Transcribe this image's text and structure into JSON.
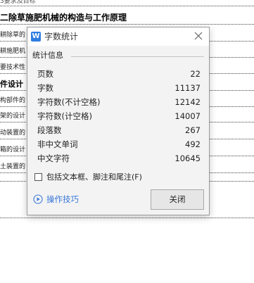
{
  "document": {
    "lines": [
      "3要求及目标",
      "二除草施肥机械的构造与工作原理",
      "耕除草的",
      "耕施肥机",
      "要技术性",
      "件设计",
      "构部件的",
      "架的设计",
      "动装置的",
      "箱的设计",
      "土装置的"
    ]
  },
  "dialog": {
    "title": "字数统计",
    "close_icon": "close-icon",
    "group_title": "统计信息",
    "stats": [
      {
        "label": "页数",
        "value": "22"
      },
      {
        "label": "字数",
        "value": "11137"
      },
      {
        "label": "字符数(不计空格)",
        "value": "12142"
      },
      {
        "label": "字符数(计空格)",
        "value": "14007"
      },
      {
        "label": "段落数",
        "value": "267"
      },
      {
        "label": "非中文单词",
        "value": "492"
      },
      {
        "label": "中文字符",
        "value": "10645"
      }
    ],
    "checkbox_label": "包括文本框、脚注和尾注(F)",
    "checkbox_checked": false,
    "tips_label": "操作技巧",
    "close_button_label": "关闭",
    "accent_color": "#3b78d8"
  }
}
